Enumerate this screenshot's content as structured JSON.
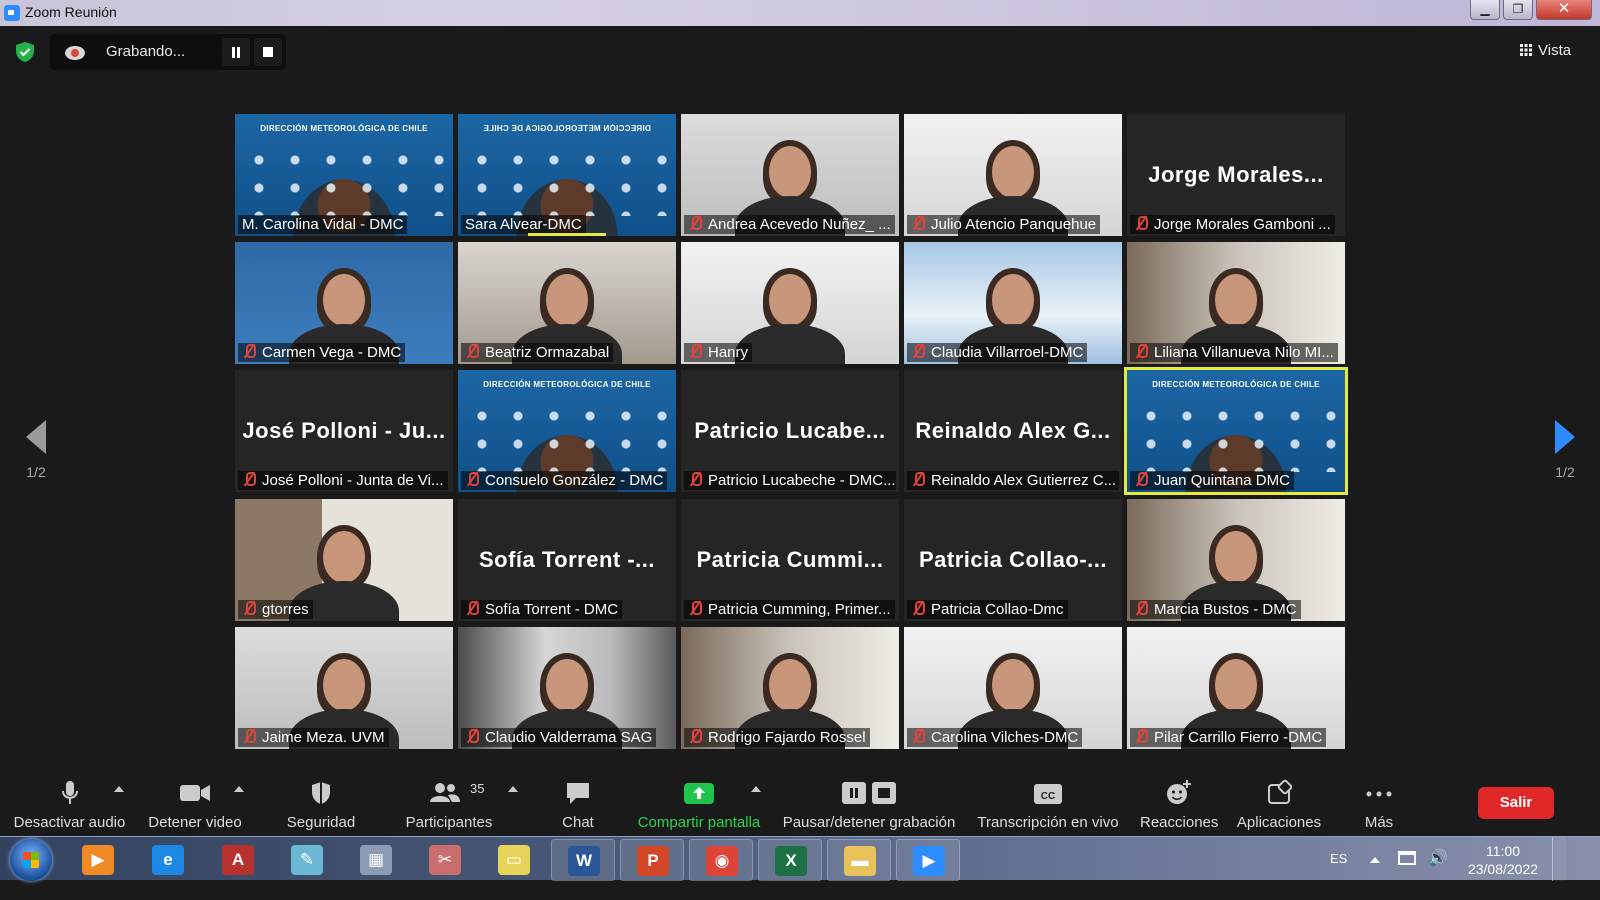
{
  "window": {
    "title": "Zoom Reunión"
  },
  "recording": {
    "label": "Grabando..."
  },
  "view": {
    "label": "Vista"
  },
  "pager": {
    "left": "1/2",
    "right": "1/2"
  },
  "tiles": [
    {
      "name": "M. Carolina Vidal - DMC",
      "muted": false,
      "bg": "dmc",
      "header": "DIRECCIÓN METEOROLÓGICA DE CHILE"
    },
    {
      "name": "Sara Alvear-DMC",
      "muted": false,
      "bg": "dmc-mirror",
      "header": "DIRECCIÓN METEOROLÓGICA DE CHILE",
      "speaking": true
    },
    {
      "name": "Andrea Acevedo Nuñez_ ...",
      "muted": true,
      "bg": "plain"
    },
    {
      "name": "Julio Atencio  Panquehue",
      "muted": true,
      "bg": "bright"
    },
    {
      "name": "Jorge Morales Gamboni ...",
      "muted": true,
      "bg": "none",
      "big": "Jorge  Morales..."
    },
    {
      "name": "Carmen Vega - DMC",
      "muted": true,
      "bg": "blue"
    },
    {
      "name": "Beatriz Ormazabal",
      "muted": true,
      "bg": "room"
    },
    {
      "name": "Hanry",
      "muted": true,
      "bg": "bright"
    },
    {
      "name": "Claudia Villarroel-DMC",
      "muted": true,
      "bg": "clouds"
    },
    {
      "name": "Liliana Villanueva Nilo MI...",
      "muted": true,
      "bg": "office"
    },
    {
      "name": "José Polloni - Junta de Vi...",
      "muted": true,
      "bg": "none",
      "big": "José  Polloni - Ju..."
    },
    {
      "name": "Consuelo González - DMC",
      "muted": true,
      "bg": "dmc",
      "header": "DIRECCIÓN METEOROLÓGICA DE CHILE"
    },
    {
      "name": "Patricio Lucabeche - DMC...",
      "muted": true,
      "bg": "none",
      "big": "Patricio  Lucabe..."
    },
    {
      "name": "Reinaldo Alex Gutierrez C...",
      "muted": true,
      "bg": "none",
      "big": "Reinaldo  Alex  G..."
    },
    {
      "name": "Juan Quintana DMC",
      "muted": true,
      "bg": "dmc",
      "header": "DIRECCIÓN METEOROLÓGICA DE CHILE",
      "active": true
    },
    {
      "name": "gtorres",
      "muted": true,
      "bg": "wall"
    },
    {
      "name": "Sofía Torrent - DMC",
      "muted": true,
      "bg": "none",
      "big": "Sofía  Torrent -..."
    },
    {
      "name": "Patricia Cumming, Primer...",
      "muted": true,
      "bg": "none",
      "big": "Patricia  Cummi..."
    },
    {
      "name": "Patricia Collao-Dmc",
      "muted": true,
      "bg": "none",
      "big": "Patricia  Collao-..."
    },
    {
      "name": "Marcia Bustos - DMC",
      "muted": true,
      "bg": "office"
    },
    {
      "name": "Jaime Meza. UVM",
      "muted": true,
      "bg": "plain"
    },
    {
      "name": "Claudio Valderrama SAG",
      "muted": true,
      "bg": "window"
    },
    {
      "name": "Rodrigo Fajardo Rossel",
      "muted": true,
      "bg": "office"
    },
    {
      "name": "Carolina Vilches-DMC",
      "muted": true,
      "bg": "bright"
    },
    {
      "name": "Pilar Carrillo Fierro -DMC",
      "muted": true,
      "bg": "bright"
    }
  ],
  "toolbar": {
    "mute": "Desactivar audio",
    "video": "Detener video",
    "security": "Seguridad",
    "participants": "Participantes",
    "participants_count": "35",
    "chat": "Chat",
    "share": "Compartir pantalla",
    "record": "Pausar/detener grabación",
    "captions": "Transcripción en vivo",
    "reactions": "Reacciones",
    "apps": "Aplicaciones",
    "more": "Más",
    "leave": "Salir"
  },
  "taskbar": {
    "apps": [
      {
        "icon": "media-player-icon",
        "glyph": "▶",
        "color": "#f08a24"
      },
      {
        "icon": "internet-explorer-icon",
        "glyph": "e",
        "color": "#1e88e5"
      },
      {
        "icon": "access-icon",
        "glyph": "A",
        "color": "#b7322c"
      },
      {
        "icon": "notes-icon",
        "glyph": "✎",
        "color": "#6bb7d6"
      },
      {
        "icon": "calculator-icon",
        "glyph": "▦",
        "color": "#8a9bb3"
      },
      {
        "icon": "paint-icon",
        "glyph": "✂",
        "color": "#c96d6d"
      },
      {
        "icon": "sticky-notes-icon",
        "glyph": "▭",
        "color": "#e6d35a"
      },
      {
        "icon": "word-icon",
        "glyph": "W",
        "color": "#2b5797"
      },
      {
        "icon": "powerpoint-icon",
        "glyph": "P",
        "color": "#d24726"
      },
      {
        "icon": "chrome-icon",
        "glyph": "◉",
        "color": "#db4437"
      },
      {
        "icon": "excel-icon",
        "glyph": "X",
        "color": "#1e7145"
      },
      {
        "icon": "explorer-icon",
        "glyph": "▬",
        "color": "#e8c25a"
      },
      {
        "icon": "zoom-icon",
        "glyph": "▶",
        "color": "#2d8cff"
      }
    ],
    "lang": "ES",
    "time": "11:00",
    "date": "23/08/2022"
  }
}
